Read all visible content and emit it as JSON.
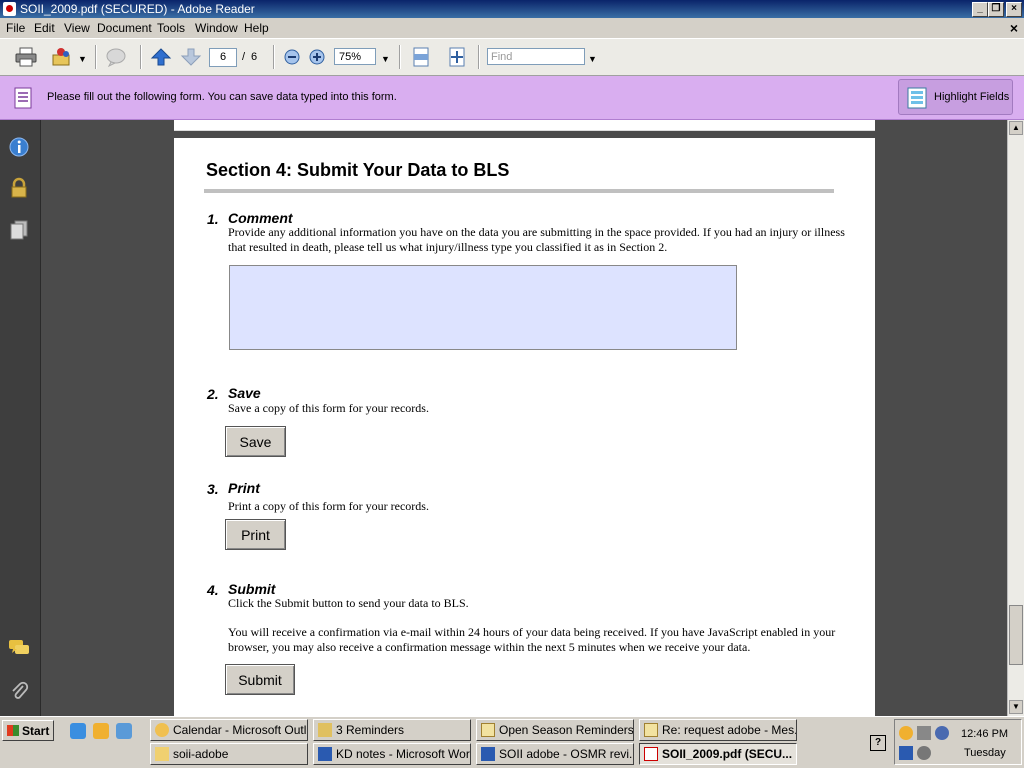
{
  "window": {
    "title": "SOII_2009.pdf (SECURED) - Adobe Reader"
  },
  "menu": {
    "items": [
      "File",
      "Edit",
      "View",
      "Document",
      "Tools",
      "Window",
      "Help"
    ]
  },
  "toolbar": {
    "page_current": "6",
    "page_separator": "/",
    "page_total": "6",
    "zoom": "75%",
    "find_placeholder": "Find"
  },
  "formbar": {
    "message": "Please fill out the following form. You can save data typed into this form.",
    "highlight_label": "Highlight Fields"
  },
  "document": {
    "section_title": "Section 4: Submit Your Data to BLS",
    "items": [
      {
        "number": "1.",
        "heading": "Comment",
        "text": "Provide any additional information you have on the data you are submitting in the space provided.  If you had an injury or illness that resulted in death, please tell us what injury/illness type you classified it as in Section 2."
      },
      {
        "number": "2.",
        "heading": "Save",
        "text": "Save a copy of this form for your records.",
        "button": "Save"
      },
      {
        "number": "3.",
        "heading": "Print",
        "text": "Print a copy of this form for your records.",
        "button": "Print"
      },
      {
        "number": "4.",
        "heading": "Submit",
        "text": "Click the Submit button to send your data to BLS.",
        "text2": "You will receive a confirmation via e-mail within 24 hours of your data being received.  If you have JavaScript enabled in your browser, you may also receive a confirmation message within the next 5 minutes when we receive your data.",
        "button": "Submit"
      }
    ]
  },
  "taskbar": {
    "start_label": "Start",
    "tasks": [
      {
        "label": "Calendar - Microsoft Outl...",
        "icon": "calendar-icon"
      },
      {
        "label": "3 Reminders",
        "icon": "bell-icon"
      },
      {
        "label": "Open Season Reminders...",
        "icon": "envelope-icon"
      },
      {
        "label": "Re: request adobe - Mes...",
        "icon": "envelope-icon"
      },
      {
        "label": "soii-adobe",
        "icon": "folder-icon"
      },
      {
        "label": "KD notes - Microsoft Word",
        "icon": "word-icon"
      },
      {
        "label": "SOII adobe - OSMR revi...",
        "icon": "word-icon"
      },
      {
        "label": "SOII_2009.pdf (SECU...",
        "icon": "pdf-icon"
      }
    ],
    "clock_time": "12:46 PM",
    "clock_day": "Tuesday"
  }
}
